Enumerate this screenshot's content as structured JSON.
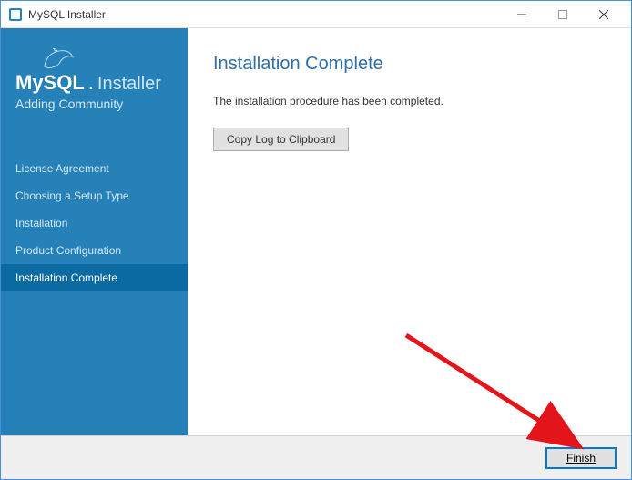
{
  "titlebar": {
    "title": "MySQL Installer"
  },
  "brand": {
    "mysql": "MySQL",
    "installer": "Installer",
    "subtitle": "Adding Community"
  },
  "sidebar": {
    "items": [
      {
        "label": "License Agreement"
      },
      {
        "label": "Choosing a Setup Type"
      },
      {
        "label": "Installation"
      },
      {
        "label": "Product Configuration"
      },
      {
        "label": "Installation Complete"
      }
    ]
  },
  "main": {
    "title": "Installation Complete",
    "description": "The installation procedure has been completed.",
    "copy_log_label": "Copy Log to Clipboard"
  },
  "footer": {
    "finish_label": "Finish"
  }
}
